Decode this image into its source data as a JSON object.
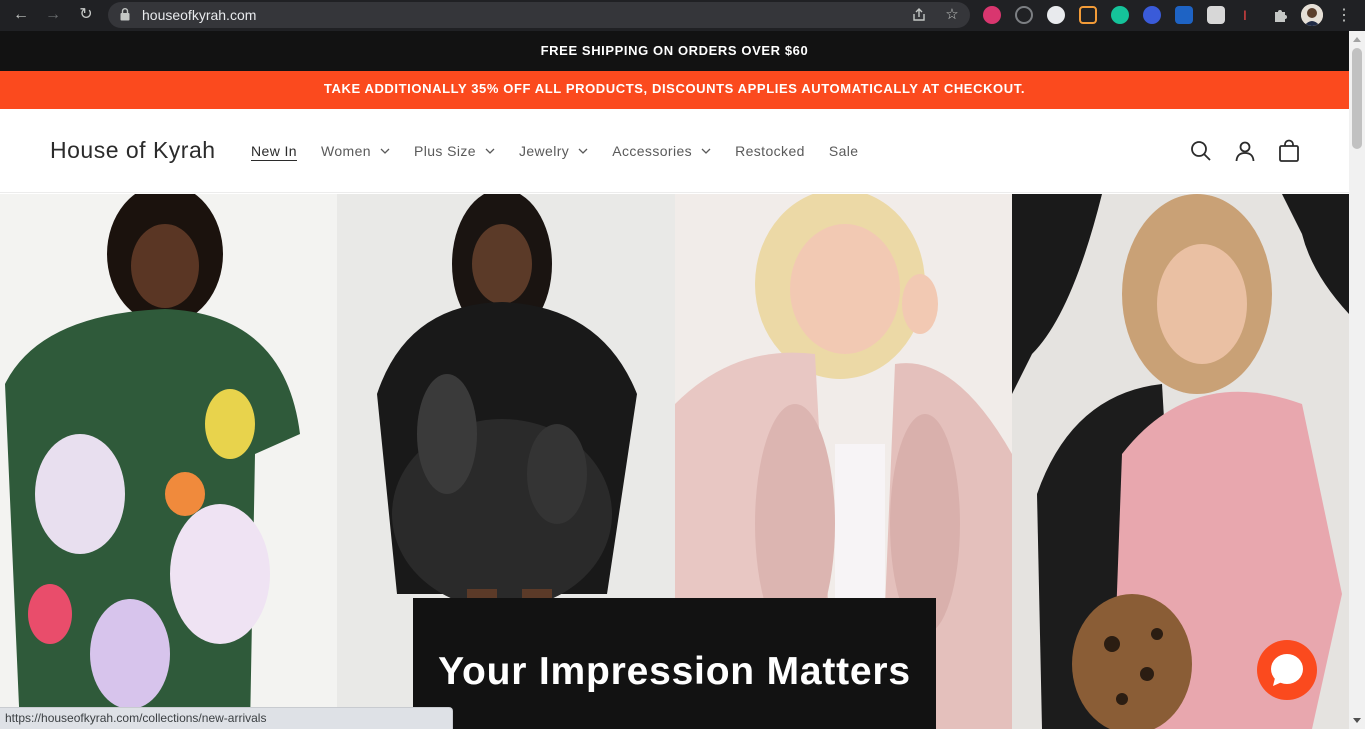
{
  "browser": {
    "url": "houseofkyrah.com",
    "status_url": "https://houseofkyrah.com/collections/new-arrivals"
  },
  "announcements": {
    "top": "FREE SHIPPING ON ORDERS OVER $60",
    "promo": "TAKE ADDITIONALLY 35% OFF ALL PRODUCTS, DISCOUNTS APPLIES AUTOMATICALLY AT CHECKOUT."
  },
  "header": {
    "logo": "House of Kyrah",
    "menu": [
      {
        "label": "New In",
        "has_dropdown": false,
        "active": true
      },
      {
        "label": "Women",
        "has_dropdown": true
      },
      {
        "label": "Plus Size",
        "has_dropdown": true
      },
      {
        "label": "Jewelry",
        "has_dropdown": true
      },
      {
        "label": "Accessories",
        "has_dropdown": true
      },
      {
        "label": "Restocked",
        "has_dropdown": false
      },
      {
        "label": "Sale",
        "has_dropdown": false
      }
    ],
    "icons": [
      "search-icon",
      "account-icon",
      "cart-icon"
    ]
  },
  "hero": {
    "caption": "Your Impression Matters"
  },
  "colors": {
    "announcement_dark": "#121212",
    "promo_orange": "#fb4a1e",
    "chat_button": "#fb4a1e"
  }
}
